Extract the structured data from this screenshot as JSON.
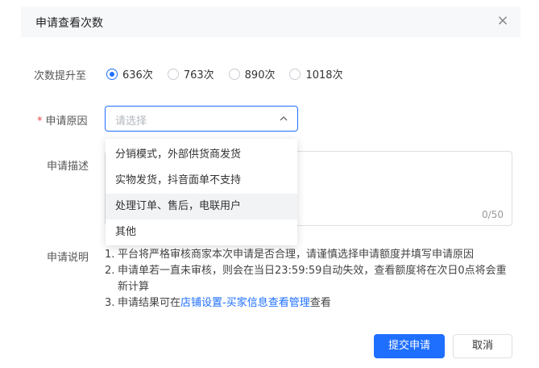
{
  "dialog": {
    "title": "申请查看次数",
    "close_icon": "×"
  },
  "form": {
    "count_label": "次数提升至",
    "count_options": [
      {
        "label": "636次",
        "selected": true
      },
      {
        "label": "763次",
        "selected": false
      },
      {
        "label": "890次",
        "selected": false
      },
      {
        "label": "1018次",
        "selected": false
      }
    ],
    "reason_required_mark": "*",
    "reason_label": "申请原因",
    "reason_placeholder": "请选择",
    "reason_options": [
      "分销模式，外部供货商发货",
      "实物发货，抖音面单不支持",
      "处理订单、售后，电联用户",
      "其他"
    ],
    "desc_label": "申请描述",
    "desc_counter": "0/50",
    "notes_label": "申请说明",
    "notes": {
      "n1_num": "1.",
      "n1": "平台将严格审核商家本次申请是否合理，请谨慎选择申请额度并填写申请原因",
      "n2_num": "2.",
      "n2": "申请单若一直未审核，则会在当日23:59:59自动失效，查看额度将在次日0点将会重新计算",
      "n3_num": "3.",
      "n3_pre": "申请结果可在",
      "n3_link": "店铺设置-买家信息查看管理",
      "n3_post": "查看"
    }
  },
  "actions": {
    "submit": "提交申请",
    "cancel": "取消"
  },
  "colors": {
    "primary": "#1f6fff",
    "required": "#e54545"
  }
}
